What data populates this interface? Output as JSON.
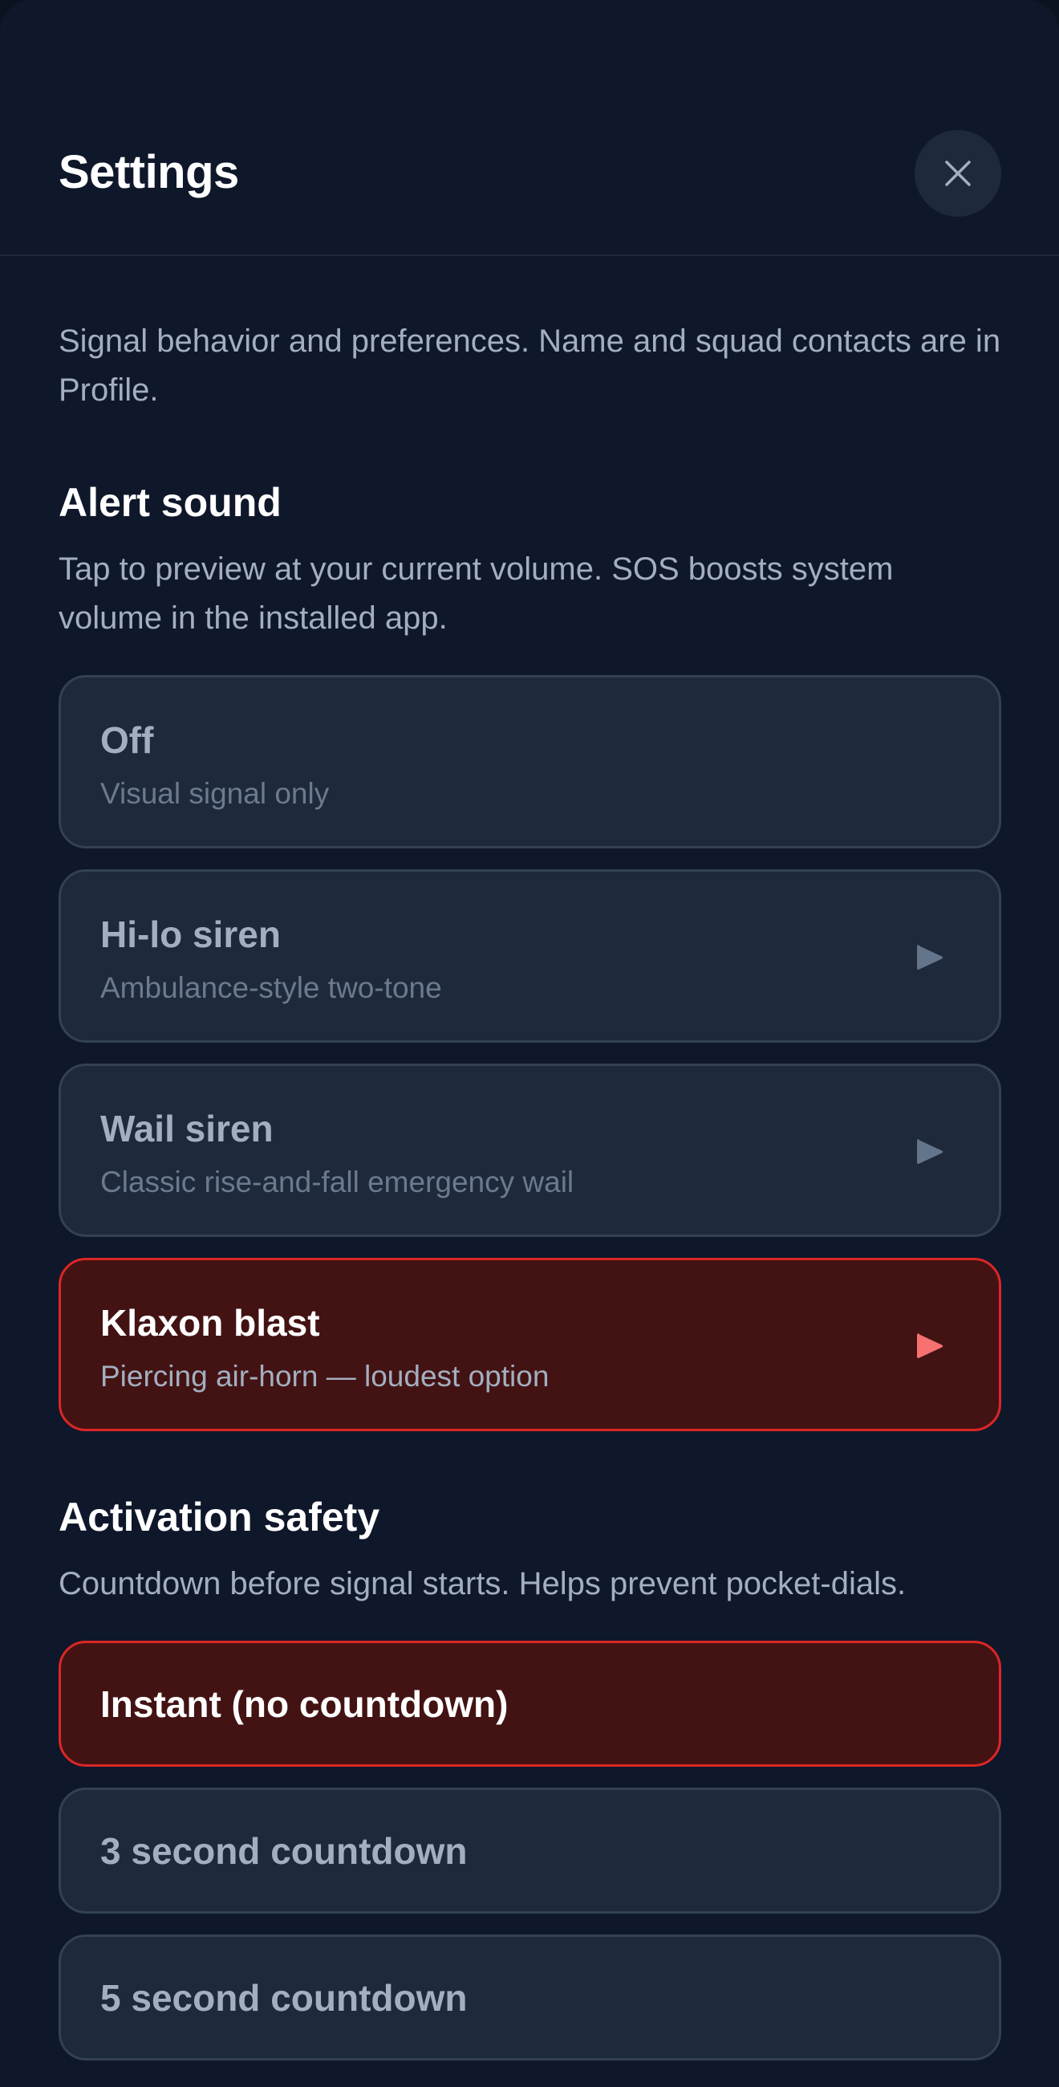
{
  "header": {
    "title": "Settings",
    "close_icon": "close-icon"
  },
  "intro": "Signal behavior and preferences. Name and squad contacts are in Profile.",
  "alert_sound": {
    "title": "Alert sound",
    "description": "Tap to preview at your current volume. SOS boosts system volume in the installed app.",
    "options": [
      {
        "label": "Off",
        "sublabel": "Visual signal only",
        "selected": false,
        "playable": false
      },
      {
        "label": "Hi-lo siren",
        "sublabel": "Ambulance-style two-tone",
        "selected": false,
        "playable": true
      },
      {
        "label": "Wail siren",
        "sublabel": "Classic rise-and-fall emergency wail",
        "selected": false,
        "playable": true
      },
      {
        "label": "Klaxon blast",
        "sublabel": "Piercing air-horn — loudest option",
        "selected": true,
        "playable": true
      }
    ]
  },
  "activation_safety": {
    "title": "Activation safety",
    "description": "Countdown before signal starts. Helps prevent pocket-dials.",
    "options": [
      {
        "label": "Instant (no countdown)",
        "selected": true
      },
      {
        "label": "3 second countdown",
        "selected": false
      },
      {
        "label": "5 second countdown",
        "selected": false
      }
    ]
  },
  "colors": {
    "background": "#0f172a",
    "card": "#1e293b",
    "card_border": "#334155",
    "selected_bg": "#431313",
    "selected_border": "#dc2626",
    "accent_play": "#f87171",
    "muted_play": "#64748b"
  }
}
